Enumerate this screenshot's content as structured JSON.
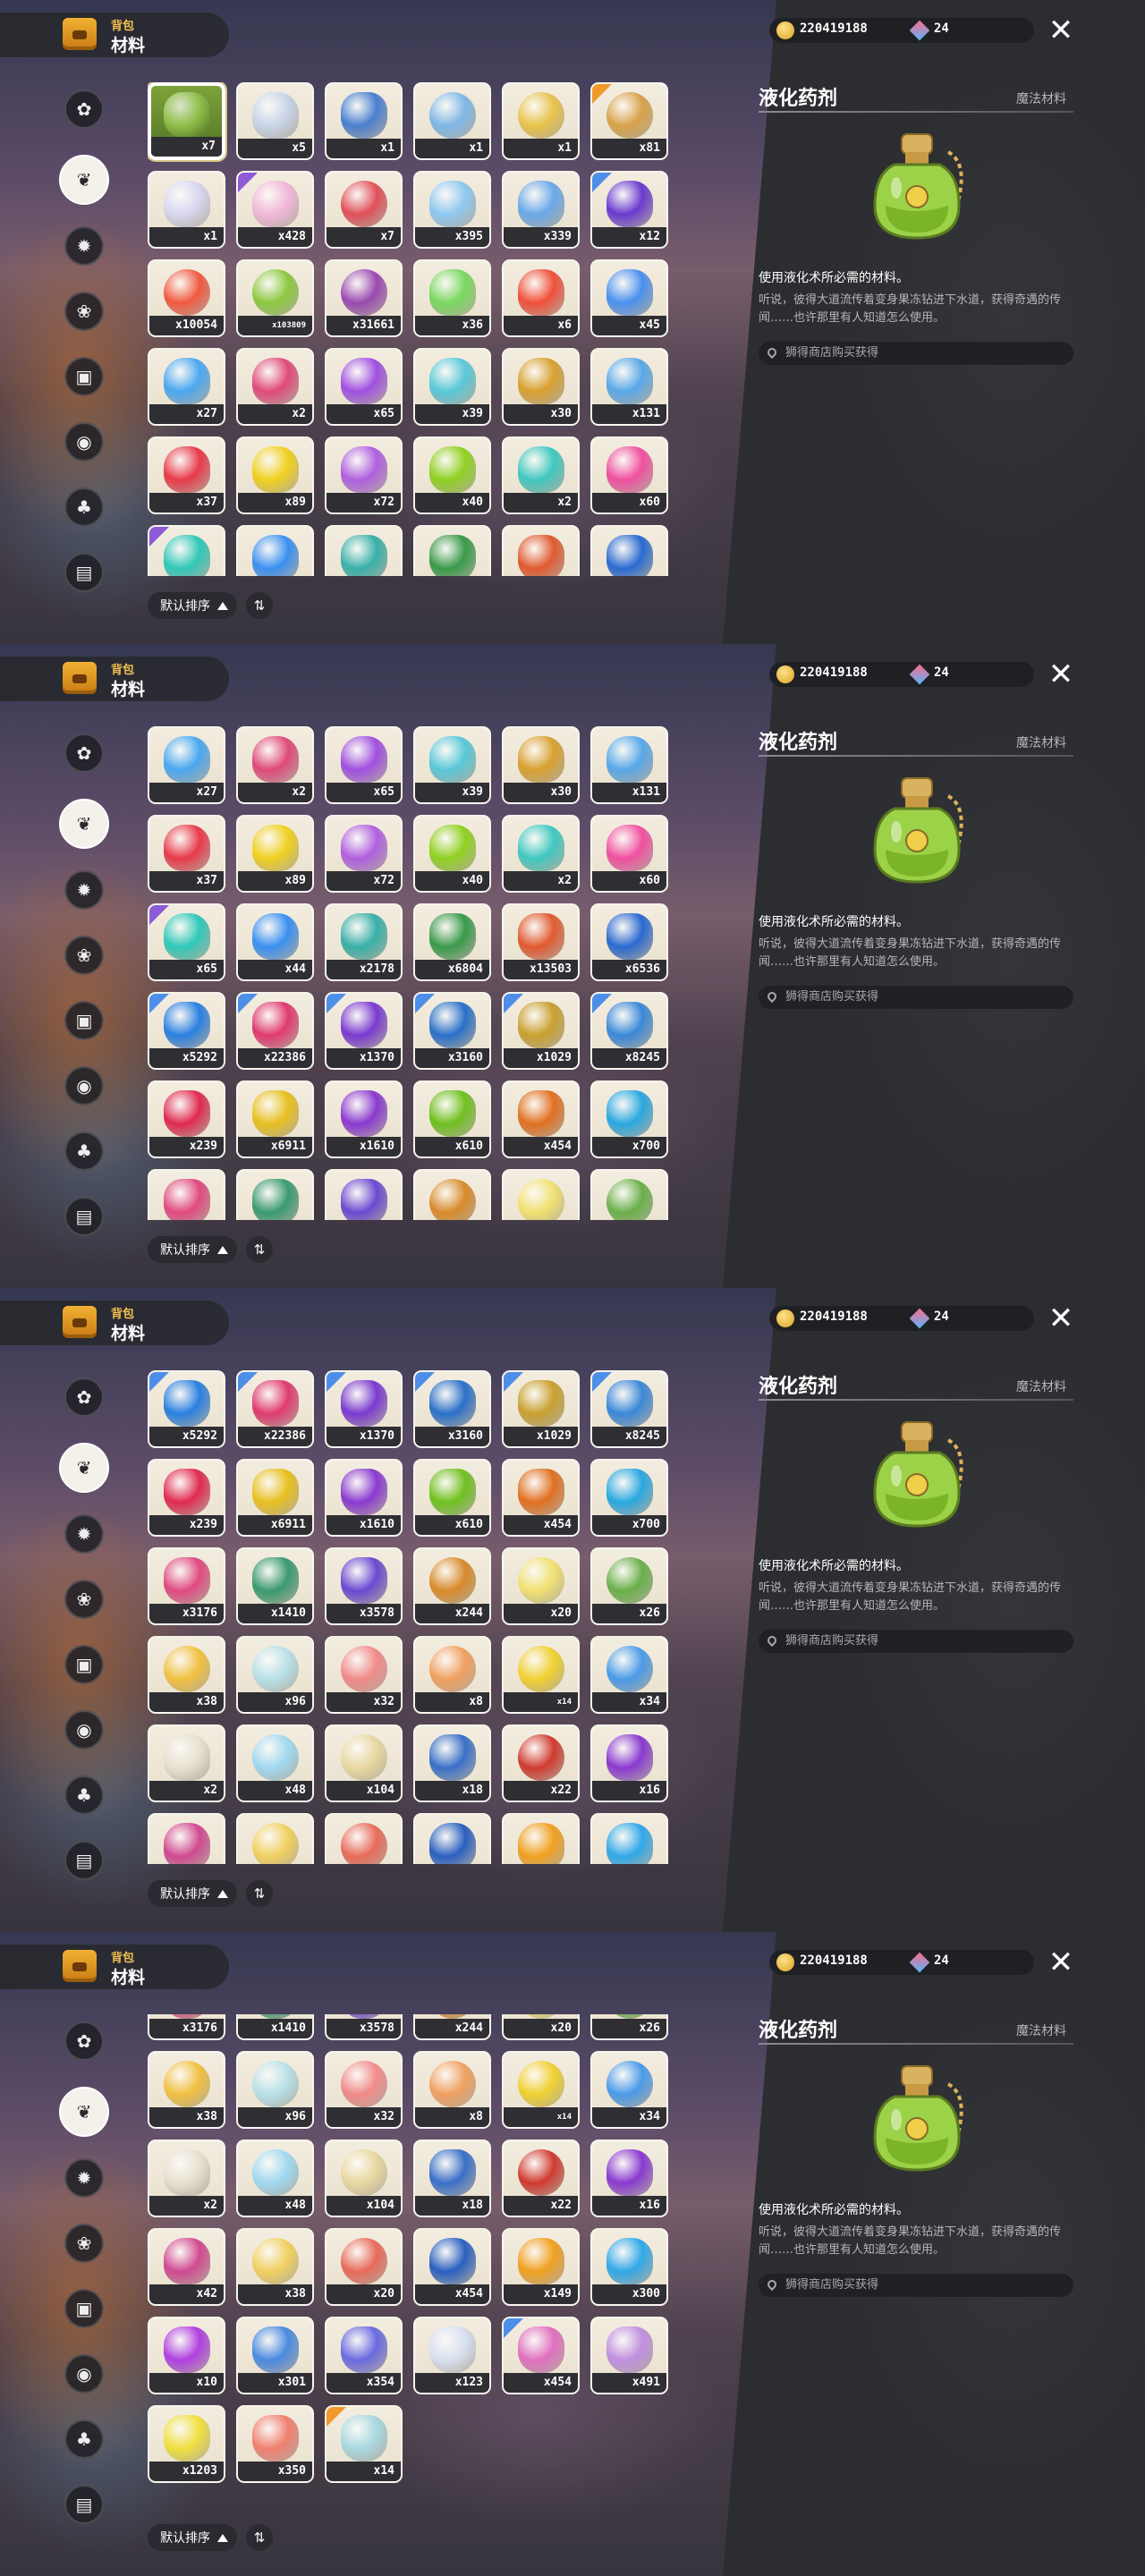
{
  "header": {
    "bag_label": "背包",
    "sub_label": "材料"
  },
  "currency": {
    "gold": "220419188",
    "gems": "24"
  },
  "categories": [
    {
      "icon": "clover"
    },
    {
      "icon": "sprout"
    },
    {
      "icon": "star"
    },
    {
      "icon": "flower"
    },
    {
      "icon": "shirt"
    },
    {
      "icon": "globe"
    },
    {
      "icon": "acorn"
    },
    {
      "icon": "crate"
    }
  ],
  "detail": {
    "title": "液化药剂",
    "type": "魔法材料",
    "desc": "使用液化术所必需的材料。",
    "lore": "听说，彼得大道流传着变身果冻钻进下水道，获得奇遇的传闻……也许那里有人知道怎么使用。",
    "source": "狮得商店购买获得"
  },
  "sort": {
    "label": "默认排序",
    "direction_icon": "⇅"
  },
  "panels": [
    {
      "items": [
        {
          "c": "x7",
          "col": "#8fc04a",
          "sh": "bottle",
          "tri": "",
          "sel": true
        },
        {
          "c": "x5",
          "col": "#c9d4e8",
          "sh": "gem",
          "tri": ""
        },
        {
          "c": "x1",
          "col": "#4a7fd0",
          "sh": "bottle",
          "tri": ""
        },
        {
          "c": "x1",
          "col": "#7fb7e6",
          "sh": "circle",
          "tri": ""
        },
        {
          "c": "x1",
          "col": "#e8c24a",
          "sh": "circle",
          "tri": ""
        },
        {
          "c": "x81",
          "col": "#d8a24a",
          "sh": "circle",
          "tri": "orange"
        },
        {
          "c": "x1",
          "col": "#d9d6f0",
          "sh": "gem",
          "tri": ""
        },
        {
          "c": "x428",
          "col": "#f0b8d8",
          "sh": "gem",
          "tri": "purple"
        },
        {
          "c": "x7",
          "col": "#e0505a",
          "sh": "circle",
          "tri": ""
        },
        {
          "c": "x395",
          "col": "#8fc8f0",
          "sh": "gem",
          "tri": ""
        },
        {
          "c": "x339",
          "col": "#6aa8e8",
          "sh": "gem",
          "tri": ""
        },
        {
          "c": "x12",
          "col": "#6a3ad0",
          "sh": "gem",
          "tri": "blue"
        },
        {
          "c": "x10054",
          "col": "#f05a40",
          "sh": "circle",
          "tri": ""
        },
        {
          "c": "x103809",
          "col": "#8cc840",
          "sh": "circle",
          "tri": "",
          "small": true
        },
        {
          "c": "x31661",
          "col": "#9a4ab0",
          "sh": "circle",
          "tri": ""
        },
        {
          "c": "x36",
          "col": "#7ad860",
          "sh": "gem",
          "tri": ""
        },
        {
          "c": "x6",
          "col": "#f0503a",
          "sh": "gem",
          "tri": ""
        },
        {
          "c": "x45",
          "col": "#4a90f0",
          "sh": "gem",
          "tri": ""
        },
        {
          "c": "x27",
          "col": "#4aa8f0",
          "sh": "gem",
          "tri": ""
        },
        {
          "c": "x2",
          "col": "#e04a7a",
          "sh": "gem",
          "tri": ""
        },
        {
          "c": "x65",
          "col": "#a050e0",
          "sh": "gem",
          "tri": ""
        },
        {
          "c": "x39",
          "col": "#58c8d8",
          "sh": "gem",
          "tri": ""
        },
        {
          "c": "x30",
          "col": "#d8a030",
          "sh": "gem",
          "tri": ""
        },
        {
          "c": "x131",
          "col": "#58a8e8",
          "sh": "gem",
          "tri": ""
        },
        {
          "c": "x37",
          "col": "#e83a4a",
          "sh": "gem",
          "tri": ""
        },
        {
          "c": "x89",
          "col": "#f0d020",
          "sh": "gem",
          "tri": ""
        },
        {
          "c": "x72",
          "col": "#b060e0",
          "sh": "gem",
          "tri": ""
        },
        {
          "c": "x40",
          "col": "#90d020",
          "sh": "gem",
          "tri": ""
        },
        {
          "c": "x2",
          "col": "#40c8c0",
          "sh": "gem",
          "tri": ""
        },
        {
          "c": "x60",
          "col": "#f050a0",
          "sh": "gem",
          "tri": ""
        },
        {
          "c": "",
          "col": "#30c8b8",
          "sh": "gem",
          "tri": "purple"
        },
        {
          "c": "",
          "col": "#3a90f0",
          "sh": "gem",
          "tri": ""
        },
        {
          "c": "",
          "col": "#38b0a8",
          "sh": "bottle",
          "tri": ""
        },
        {
          "c": "",
          "col": "#3a9a4a",
          "sh": "bottle",
          "tri": ""
        },
        {
          "c": "",
          "col": "#e05a30",
          "sh": "bottle",
          "tri": ""
        },
        {
          "c": "",
          "col": "#2a6ad0",
          "sh": "bottle",
          "tri": ""
        }
      ]
    },
    {
      "items": [
        {
          "c": "x27",
          "col": "#4aa8f0",
          "sh": "gem",
          "tri": ""
        },
        {
          "c": "x2",
          "col": "#e04a7a",
          "sh": "gem",
          "tri": ""
        },
        {
          "c": "x65",
          "col": "#a050e0",
          "sh": "gem",
          "tri": ""
        },
        {
          "c": "x39",
          "col": "#58c8d8",
          "sh": "gem",
          "tri": ""
        },
        {
          "c": "x30",
          "col": "#d8a030",
          "sh": "gem",
          "tri": ""
        },
        {
          "c": "x131",
          "col": "#58a8e8",
          "sh": "gem",
          "tri": ""
        },
        {
          "c": "x37",
          "col": "#e83a4a",
          "sh": "gem",
          "tri": ""
        },
        {
          "c": "x89",
          "col": "#f0d020",
          "sh": "gem",
          "tri": ""
        },
        {
          "c": "x72",
          "col": "#b060e0",
          "sh": "gem",
          "tri": ""
        },
        {
          "c": "x40",
          "col": "#90d020",
          "sh": "gem",
          "tri": ""
        },
        {
          "c": "x2",
          "col": "#40c8c0",
          "sh": "gem",
          "tri": ""
        },
        {
          "c": "x60",
          "col": "#f050a0",
          "sh": "gem",
          "tri": ""
        },
        {
          "c": "x65",
          "col": "#30c8b8",
          "sh": "gem",
          "tri": "purple"
        },
        {
          "c": "x44",
          "col": "#3a90f0",
          "sh": "gem",
          "tri": ""
        },
        {
          "c": "x2178",
          "col": "#38b0a8",
          "sh": "bottle",
          "tri": ""
        },
        {
          "c": "x6804",
          "col": "#3a9a4a",
          "sh": "bottle",
          "tri": ""
        },
        {
          "c": "x13503",
          "col": "#e05a30",
          "sh": "bottle",
          "tri": ""
        },
        {
          "c": "x6536",
          "col": "#2a6ad0",
          "sh": "bottle",
          "tri": ""
        },
        {
          "c": "x5292",
          "col": "#2a80e0",
          "sh": "bottle",
          "tri": "blue"
        },
        {
          "c": "x22386",
          "col": "#e03a70",
          "sh": "bottle",
          "tri": "blue"
        },
        {
          "c": "x1370",
          "col": "#7a3ad0",
          "sh": "bottle",
          "tri": "blue"
        },
        {
          "c": "x3160",
          "col": "#2a70c8",
          "sh": "bottle",
          "tri": "blue"
        },
        {
          "c": "x1029",
          "col": "#c8a030",
          "sh": "bottle",
          "tri": "blue"
        },
        {
          "c": "x8245",
          "col": "#3a88d8",
          "sh": "bottle",
          "tri": "blue"
        },
        {
          "c": "x239",
          "col": "#e02a50",
          "sh": "bottle",
          "tri": ""
        },
        {
          "c": "x6911",
          "col": "#e8c020",
          "sh": "bottle",
          "tri": ""
        },
        {
          "c": "x1610",
          "col": "#8a3ad0",
          "sh": "bottle",
          "tri": ""
        },
        {
          "c": "x610",
          "col": "#70c020",
          "sh": "bottle",
          "tri": ""
        },
        {
          "c": "x454",
          "col": "#e07020",
          "sh": "bottle",
          "tri": ""
        },
        {
          "c": "x700",
          "col": "#2aa8e0",
          "sh": "bottle",
          "tri": ""
        },
        {
          "c": "",
          "col": "#e04a80",
          "sh": "bottle",
          "tri": ""
        },
        {
          "c": "",
          "col": "#3a9a70",
          "sh": "bottle",
          "tri": ""
        },
        {
          "c": "",
          "col": "#6a4ad0",
          "sh": "bottle",
          "tri": ""
        },
        {
          "c": "",
          "col": "#d88a2a",
          "sh": "circle",
          "tri": ""
        },
        {
          "c": "",
          "col": "#f0e070",
          "sh": "circle",
          "tri": ""
        },
        {
          "c": "",
          "col": "#6ab04a",
          "sh": "circle",
          "tri": ""
        }
      ]
    },
    {
      "items": [
        {
          "c": "x5292",
          "col": "#2a80e0",
          "sh": "bottle",
          "tri": "blue"
        },
        {
          "c": "x22386",
          "col": "#e03a70",
          "sh": "bottle",
          "tri": "blue"
        },
        {
          "c": "x1370",
          "col": "#7a3ad0",
          "sh": "bottle",
          "tri": "blue"
        },
        {
          "c": "x3160",
          "col": "#2a70c8",
          "sh": "bottle",
          "tri": "blue"
        },
        {
          "c": "x1029",
          "col": "#c8a030",
          "sh": "bottle",
          "tri": "blue"
        },
        {
          "c": "x8245",
          "col": "#3a88d8",
          "sh": "bottle",
          "tri": "blue"
        },
        {
          "c": "x239",
          "col": "#e02a50",
          "sh": "bottle",
          "tri": ""
        },
        {
          "c": "x6911",
          "col": "#e8c020",
          "sh": "bottle",
          "tri": ""
        },
        {
          "c": "x1610",
          "col": "#8a3ad0",
          "sh": "bottle",
          "tri": ""
        },
        {
          "c": "x610",
          "col": "#70c020",
          "sh": "bottle",
          "tri": ""
        },
        {
          "c": "x454",
          "col": "#e07020",
          "sh": "bottle",
          "tri": ""
        },
        {
          "c": "x700",
          "col": "#2aa8e0",
          "sh": "bottle",
          "tri": ""
        },
        {
          "c": "x3176",
          "col": "#e04a80",
          "sh": "bottle",
          "tri": ""
        },
        {
          "c": "x1410",
          "col": "#3a9a70",
          "sh": "bottle",
          "tri": ""
        },
        {
          "c": "x3578",
          "col": "#6a4ad0",
          "sh": "bottle",
          "tri": ""
        },
        {
          "c": "x244",
          "col": "#d88a2a",
          "sh": "circle",
          "tri": ""
        },
        {
          "c": "x20",
          "col": "#f0e070",
          "sh": "circle",
          "tri": ""
        },
        {
          "c": "x26",
          "col": "#6ab04a",
          "sh": "circle",
          "tri": ""
        },
        {
          "c": "x38",
          "col": "#f0c040",
          "sh": "circle",
          "tri": ""
        },
        {
          "c": "x96",
          "col": "#b8e0e8",
          "sh": "circle",
          "tri": ""
        },
        {
          "c": "x32",
          "col": "#f08a8a",
          "sh": "circle",
          "tri": ""
        },
        {
          "c": "x8",
          "col": "#f0a060",
          "sh": "circle",
          "tri": ""
        },
        {
          "c": "x14",
          "col": "#f0d030",
          "sh": "circle",
          "tri": "",
          "small": true
        },
        {
          "c": "x34",
          "col": "#4a9ae8",
          "sh": "circle",
          "tri": ""
        },
        {
          "c": "x2",
          "col": "#e8e0d0",
          "sh": "gem",
          "tri": ""
        },
        {
          "c": "x48",
          "col": "#a0d8f0",
          "sh": "circle",
          "tri": ""
        },
        {
          "c": "x104",
          "col": "#e8d8a0",
          "sh": "circle",
          "tri": ""
        },
        {
          "c": "x18",
          "col": "#3a70c8",
          "sh": "bottle",
          "tri": ""
        },
        {
          "c": "x22",
          "col": "#d03a30",
          "sh": "circle",
          "tri": ""
        },
        {
          "c": "x16",
          "col": "#8a3ad0",
          "sh": "gem",
          "tri": ""
        },
        {
          "c": "",
          "col": "#d04a90",
          "sh": "gem",
          "tri": ""
        },
        {
          "c": "",
          "col": "#f0d060",
          "sh": "circle",
          "tri": ""
        },
        {
          "c": "",
          "col": "#e86a5a",
          "sh": "circle",
          "tri": ""
        },
        {
          "c": "",
          "col": "#2a60c0",
          "sh": "gem",
          "tri": ""
        },
        {
          "c": "",
          "col": "#f0a020",
          "sh": "gem",
          "tri": ""
        },
        {
          "c": "",
          "col": "#30a8e8",
          "sh": "gem",
          "tri": ""
        }
      ]
    },
    {
      "items": [
        {
          "c": "x3176",
          "col": "#e04a80",
          "sh": "bottle",
          "tri": ""
        },
        {
          "c": "x1410",
          "col": "#3a9a70",
          "sh": "bottle",
          "tri": ""
        },
        {
          "c": "x3578",
          "col": "#6a4ad0",
          "sh": "bottle",
          "tri": ""
        },
        {
          "c": "x244",
          "col": "#d88a2a",
          "sh": "circle",
          "tri": ""
        },
        {
          "c": "x20",
          "col": "#f0e070",
          "sh": "circle",
          "tri": ""
        },
        {
          "c": "x26",
          "col": "#6ab04a",
          "sh": "circle",
          "tri": ""
        },
        {
          "c": "x38",
          "col": "#f0c040",
          "sh": "circle",
          "tri": ""
        },
        {
          "c": "x96",
          "col": "#b8e0e8",
          "sh": "circle",
          "tri": ""
        },
        {
          "c": "x32",
          "col": "#f08a8a",
          "sh": "circle",
          "tri": ""
        },
        {
          "c": "x8",
          "col": "#f0a060",
          "sh": "circle",
          "tri": ""
        },
        {
          "c": "x14",
          "col": "#f0d030",
          "sh": "circle",
          "tri": "",
          "small": true
        },
        {
          "c": "x34",
          "col": "#4a9ae8",
          "sh": "circle",
          "tri": ""
        },
        {
          "c": "x2",
          "col": "#e8e0d0",
          "sh": "gem",
          "tri": ""
        },
        {
          "c": "x48",
          "col": "#a0d8f0",
          "sh": "circle",
          "tri": ""
        },
        {
          "c": "x104",
          "col": "#e8d8a0",
          "sh": "circle",
          "tri": ""
        },
        {
          "c": "x18",
          "col": "#3a70c8",
          "sh": "bottle",
          "tri": ""
        },
        {
          "c": "x22",
          "col": "#d03a30",
          "sh": "circle",
          "tri": ""
        },
        {
          "c": "x16",
          "col": "#8a3ad0",
          "sh": "gem",
          "tri": ""
        },
        {
          "c": "x42",
          "col": "#d04a90",
          "sh": "gem",
          "tri": ""
        },
        {
          "c": "x38",
          "col": "#f0d060",
          "sh": "circle",
          "tri": ""
        },
        {
          "c": "x20",
          "col": "#e86a5a",
          "sh": "circle",
          "tri": ""
        },
        {
          "c": "x454",
          "col": "#2a60c0",
          "sh": "gem",
          "tri": ""
        },
        {
          "c": "x149",
          "col": "#f0a020",
          "sh": "gem",
          "tri": ""
        },
        {
          "c": "x300",
          "col": "#30a8e8",
          "sh": "gem",
          "tri": ""
        },
        {
          "c": "x10",
          "col": "#b040e0",
          "sh": "bottle",
          "tri": ""
        },
        {
          "c": "x301",
          "col": "#4a8ae0",
          "sh": "bottle",
          "tri": ""
        },
        {
          "c": "x354",
          "col": "#6a6ae0",
          "sh": "bottle",
          "tri": ""
        },
        {
          "c": "x123",
          "col": "#d8e0f0",
          "sh": "bottle",
          "tri": ""
        },
        {
          "c": "x454",
          "col": "#e070c0",
          "sh": "bottle",
          "tri": "blue"
        },
        {
          "c": "x491",
          "col": "#c090e0",
          "sh": "bottle",
          "tri": ""
        },
        {
          "c": "x1203",
          "col": "#f0e040",
          "sh": "bottle",
          "tri": ""
        },
        {
          "c": "x350",
          "col": "#f08070",
          "sh": "bottle",
          "tri": ""
        },
        {
          "c": "x14",
          "col": "#a8d8e0",
          "sh": "bottle",
          "tri": "orange"
        }
      ]
    }
  ]
}
